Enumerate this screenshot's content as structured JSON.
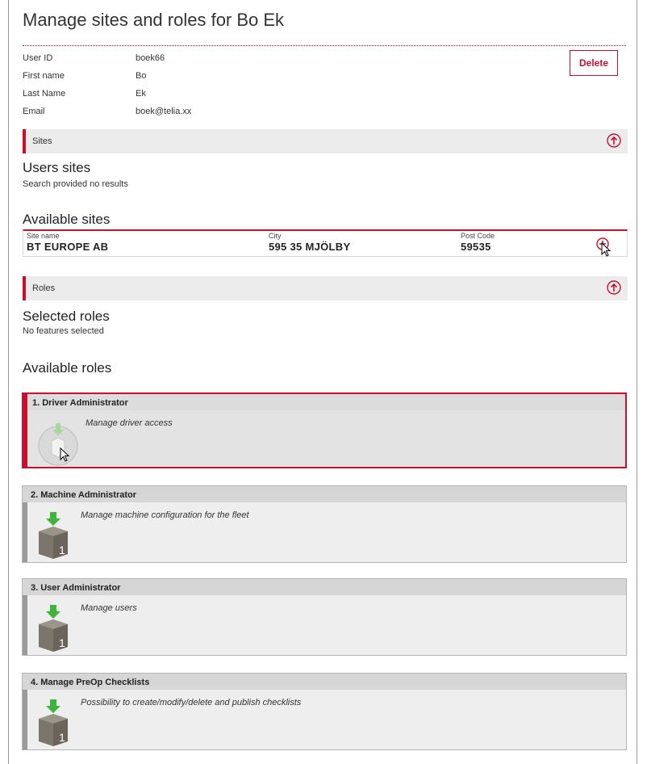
{
  "page": {
    "title": "Manage sites and roles for Bo Ek"
  },
  "user": {
    "fields": [
      {
        "label": "User ID",
        "value": "boek66"
      },
      {
        "label": "First name",
        "value": "Bo"
      },
      {
        "label": "Last Name",
        "value": "Ek"
      },
      {
        "label": "Email",
        "value": "boek@telia.xx"
      }
    ],
    "delete_label": "Delete"
  },
  "sites": {
    "section_label": "Sites",
    "users_sites_heading": "Users sites",
    "users_sites_empty": "Search provided no results",
    "available_heading": "Available sites",
    "columns": [
      "Site name",
      "City",
      "Post Code"
    ],
    "rows": [
      {
        "site_name": "BT EUROPE AB",
        "city": "595 35 MJÖLBY",
        "post_code": "59535"
      }
    ]
  },
  "roles": {
    "section_label": "Roles",
    "selected_heading": "Selected roles",
    "selected_empty": "No features selected",
    "available_heading": "Available roles",
    "items": [
      {
        "title": "1. Driver Administrator",
        "description": "Manage driver access",
        "selected": true
      },
      {
        "title": "2. Machine Administrator",
        "description": "Manage machine configuration for the fleet",
        "selected": false
      },
      {
        "title": "3. User Administrator",
        "description": "Manage users",
        "selected": false
      },
      {
        "title": "4. Manage PreOp Checklists",
        "description": "Possibility to create/modify/delete and publish checklists",
        "selected": false
      }
    ]
  },
  "colors": {
    "accent": "#c8102e",
    "section_bg": "#ececec",
    "card_bg": "#eeeeee"
  },
  "icons": [
    "arrow-up-circle-icon",
    "add-circle-icon",
    "role-box-icon",
    "mouse-cursor-icon"
  ]
}
